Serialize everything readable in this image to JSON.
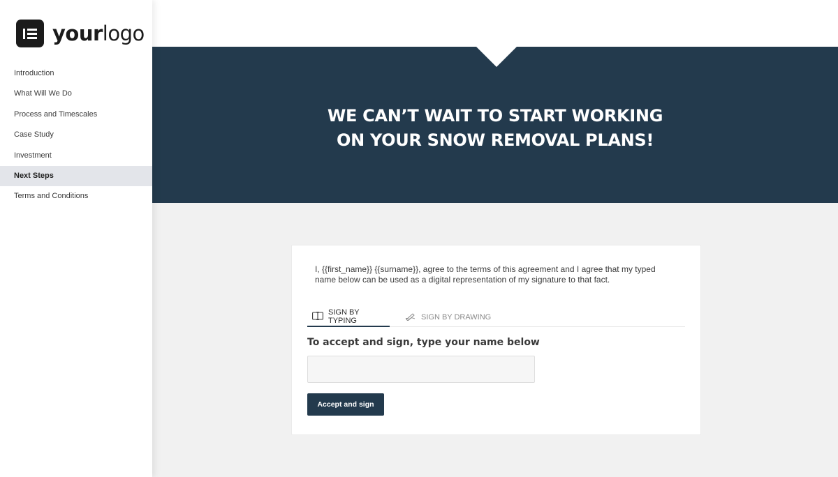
{
  "logo": {
    "text_bold": "your",
    "text_regular": "logo",
    "icon": "elementor-logo-icon"
  },
  "sidebar": {
    "items": [
      {
        "label": "Introduction"
      },
      {
        "label": "What Will We Do"
      },
      {
        "label": "Process and Timescales"
      },
      {
        "label": "Case Study"
      },
      {
        "label": "Investment"
      },
      {
        "label": "Next Steps",
        "active": true
      },
      {
        "label": "Terms and Conditions"
      }
    ]
  },
  "hero": {
    "line1": "WE CAN’T WAIT TO START WORKING",
    "line2": "ON YOUR SNOW REMOVAL PLANS!",
    "background_color": "#233a4d"
  },
  "signature": {
    "agreement": "I, {{first_name}} {{surname}}, agree to the terms of this agreement and I agree that my typed name below can be used as a digital representation of my signature to that fact.",
    "tabs": [
      {
        "label": "SIGN BY TYPING",
        "icon": "keyboard-icon",
        "active": true
      },
      {
        "label": "SIGN BY DRAWING",
        "icon": "pen-icon",
        "active": false
      }
    ],
    "instruction": "To accept and sign, type your name below",
    "input_value": "",
    "input_placeholder": "",
    "button_label": "Accept and sign"
  },
  "colors": {
    "accent": "#233a4d",
    "page_bg": "#f1f1f1",
    "active_nav_bg": "#e3e5ea"
  }
}
